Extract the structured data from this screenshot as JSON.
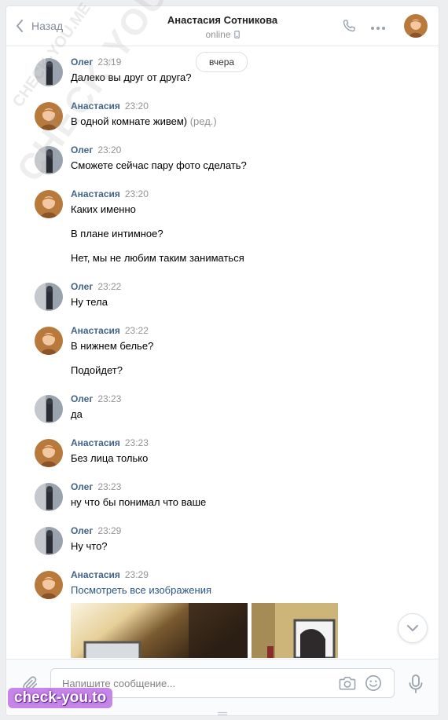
{
  "header": {
    "back_label": "Назад",
    "title": "Анастасия Сотникова",
    "status": "online"
  },
  "history": {
    "date_pill": "вчера",
    "messages": [
      {
        "author": "Олег",
        "time": "23:19",
        "lines": [
          "Далеко вы друг от друга?"
        ]
      },
      {
        "author": "Анастасия",
        "time": "23:20",
        "lines": [
          "В одной комнате живем)"
        ],
        "edited": "(ред.)"
      },
      {
        "author": "Олег",
        "time": "23:20",
        "lines": [
          "Сможете сейчас пару фото сделать?"
        ]
      },
      {
        "author": "Анастасия",
        "time": "23:20",
        "lines": [
          "Каких именно",
          "В плане интимное?",
          "Нет, мы не любим таким заниматься"
        ]
      },
      {
        "author": "Олег",
        "time": "23:22",
        "lines": [
          "Ну тела"
        ]
      },
      {
        "author": "Анастасия",
        "time": "23:22",
        "lines": [
          "В нижнем белье?",
          "Подойдет?"
        ]
      },
      {
        "author": "Олег",
        "time": "23:23",
        "lines": [
          "да"
        ]
      },
      {
        "author": "Анастасия",
        "time": "23:23",
        "lines": [
          "Без лица только"
        ]
      },
      {
        "author": "Олег",
        "time": "23:23",
        "lines": [
          "ну что бы понимал что ваше"
        ]
      },
      {
        "author": "Олег",
        "time": "23:29",
        "lines": [
          "Ну что?"
        ]
      },
      {
        "author": "Анастасия",
        "time": "23:29",
        "link": "Посмотреть все изображения"
      }
    ]
  },
  "composer": {
    "placeholder": "Напишите сообщение..."
  },
  "watermarks": {
    "diagonal": "CHECK-YOU.ME",
    "badge": "check-you.to"
  },
  "icons": {
    "back": "chevron-left-icon",
    "call": "phone-icon",
    "more": "more-dots-icon",
    "mobile": "mobile-device-icon",
    "attach": "paperclip-icon",
    "camera": "camera-icon",
    "emoji": "smile-icon",
    "voice": "microphone-icon",
    "scroll": "chevron-down-icon"
  },
  "colors": {
    "author": "#42648b",
    "link": "#2a5885",
    "muted": "#939393",
    "page_bg": "#edeef0"
  }
}
